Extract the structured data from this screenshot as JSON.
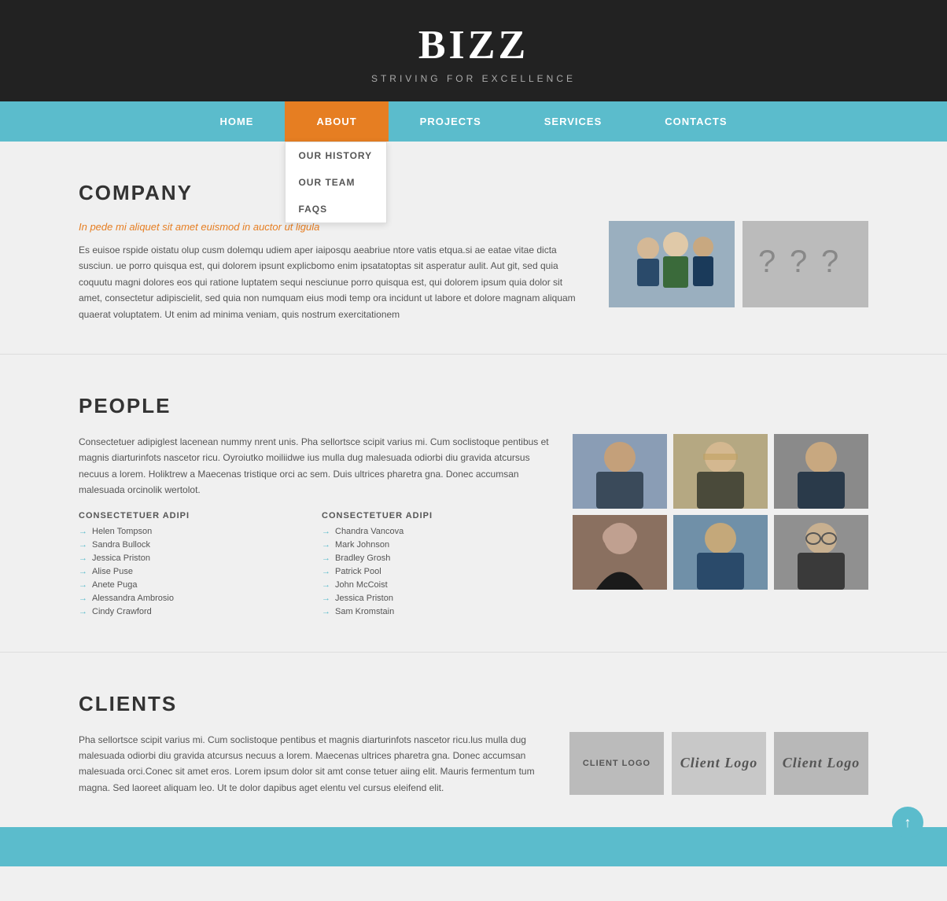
{
  "header": {
    "title": "BIZZ",
    "subtitle": "STRIVING FOR EXCELLENCE"
  },
  "nav": {
    "items": [
      {
        "label": "HOME",
        "active": false
      },
      {
        "label": "ABOUT",
        "active": true,
        "dropdown": [
          "OUR HISTORY",
          "OUR TEAM",
          "FAQs"
        ]
      },
      {
        "label": "PROJECTS",
        "active": false
      },
      {
        "label": "SERVICES",
        "active": false
      },
      {
        "label": "CONTACTS",
        "active": false
      }
    ]
  },
  "company_section": {
    "title": "COMPANY",
    "highlight": "In pede mi aliquet sit amet euismod in auctor ut ligula",
    "body": "Es euisoe rspide oistatu olup cusm dolemqu udiem aper iaiposqu aeabriue ntore vatis etqua.si ae eatae vitae dicta susciun. ue porro quisqua est, qui dolorem ipsunt explicbomo enim ipsatatoptas sit asperatur aulit. Aut git, sed quia coquutu magni dolores eos qui ratione luptatem sequi nesciunue porro quisqua est, qui dolorem ipsum quia dolor sit amet, consectetur adipiscielit, sed quia non numquam eius modi temp ora incidunt ut labore et dolore magnam aliquam quaerat voluptatem. Ut enim ad minima veniam, quis nostrum exercitationem"
  },
  "people_section": {
    "title": "PEOPLE",
    "body": "Consectetuer adipiglest lacenean nummy nrent unis. Pha sellortsce scipit varius mi. Cum soclistoque pentibus et magnis diarturinfots nascetor ricu. Oyroiutko moiliidwe ius mulla dug malesuada odiorbi diu gravida atcursus necuus a lorem. Holiktrew a Maecenas tristique orci ac sem. Duis ultrices pharetra gna. Donec accumsan malesuada orcinolik wertolot.",
    "list1_title": "Consectetuer adipi",
    "list2_title": "Consectetuer adipi",
    "list1": [
      "Helen Tompson",
      "Sandra Bullock",
      "Jessica Priston",
      "Alise Puse",
      "Anete Puga",
      "Alessandra Ambrosio",
      "Cindy Crawford"
    ],
    "list2": [
      "Chandra Vancova",
      "Mark Johnson",
      "Bradley Grosh",
      "Patrick Pool",
      "John McCoist",
      "Jessica Priston",
      "Sam Kromstain"
    ]
  },
  "clients_section": {
    "title": "CLIENTS",
    "body": "Pha sellortsce scipit varius mi. Cum soclistoque pentibus et magnis diarturinfots nascetor ricu.lus mulla dug malesuada odiorbi diu gravida atcursus necuus a lorem. Maecenas ultrices pharetra gna. Donec accumsan malesuada orci.Conec sit amet eros. Lorem ipsum dolor sit amt conse tetuer aiing elit. Mauris fermentum tum magna. Sed laoreet aliquam leo. Ut te dolor dapibus aget elentu vel cursus eleifend elit.",
    "logos": [
      {
        "label": "CLIENT LOGO",
        "style": "normal"
      },
      {
        "label": "Client Logo",
        "style": "italic"
      },
      {
        "label": "Client Logo",
        "style": "italic-bold"
      }
    ]
  },
  "scroll_up_label": "↑"
}
